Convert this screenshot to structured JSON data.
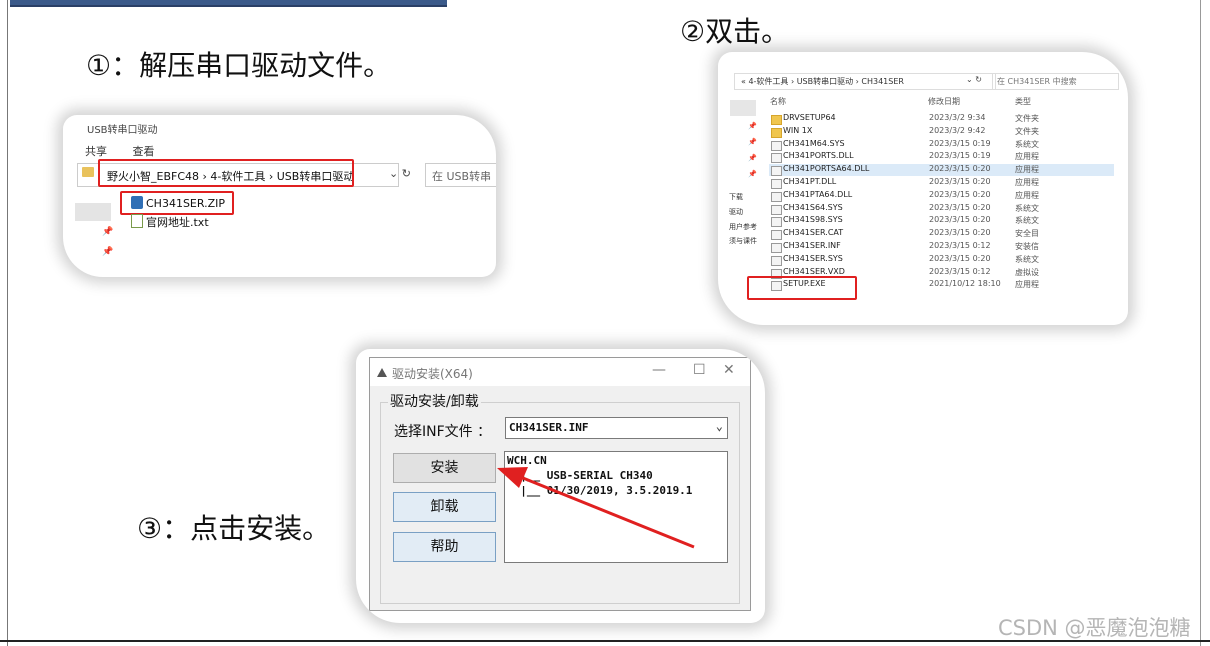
{
  "steps": {
    "step1": "①：解压串口驱动文件。",
    "step2": "②双击。",
    "step3": "③：点击安装。"
  },
  "panel1": {
    "window_title": "USB转串口驱动",
    "menu": [
      "共享",
      "查看"
    ],
    "address_path": "野火小智_EBFC48  ›  4-软件工具  ›  USB转串口驱动",
    "search_placeholder": "在 USB转串",
    "files": [
      {
        "name": "CH341SER.ZIP",
        "icon": "zip-icon"
      },
      {
        "name": "官网地址.txt",
        "icon": "txt-icon"
      }
    ]
  },
  "panel2": {
    "address_path": "«  4-软件工具  ›  USB转串口驱动  ›  CH341SER",
    "search_placeholder": "在 CH341SER 中搜索",
    "columns": [
      "名称",
      "修改日期",
      "类型"
    ],
    "sidebar": [
      "下载",
      "驱动",
      "用户参考",
      "须与课件"
    ],
    "files": [
      {
        "name": "DRVSETUP64",
        "date": "2023/3/2 9:34",
        "type": "文件夹",
        "folder": true
      },
      {
        "name": "WIN 1X",
        "date": "2023/3/2 9:42",
        "type": "文件夹",
        "folder": true
      },
      {
        "name": "CH341M64.SYS",
        "date": "2023/3/15 0:19",
        "type": "系统文",
        "folder": false
      },
      {
        "name": "CH341PORTS.DLL",
        "date": "2023/3/15 0:19",
        "type": "应用程",
        "folder": false
      },
      {
        "name": "CH341PORTSA64.DLL",
        "date": "2023/3/15 0:20",
        "type": "应用程",
        "folder": false
      },
      {
        "name": "CH341PT.DLL",
        "date": "2023/3/15 0:20",
        "type": "应用程",
        "folder": false
      },
      {
        "name": "CH341PTA64.DLL",
        "date": "2023/3/15 0:20",
        "type": "应用程",
        "folder": false
      },
      {
        "name": "CH341S64.SYS",
        "date": "2023/3/15 0:20",
        "type": "系统文",
        "folder": false
      },
      {
        "name": "CH341S98.SYS",
        "date": "2023/3/15 0:20",
        "type": "系统文",
        "folder": false
      },
      {
        "name": "CH341SER.CAT",
        "date": "2023/3/15 0:20",
        "type": "安全目",
        "folder": false
      },
      {
        "name": "CH341SER.INF",
        "date": "2023/3/15 0:12",
        "type": "安装信",
        "folder": false
      },
      {
        "name": "CH341SER.SYS",
        "date": "2023/3/15 0:20",
        "type": "系统文",
        "folder": false
      },
      {
        "name": "CH341SER.VXD",
        "date": "2023/3/15 0:12",
        "type": "虚拟设",
        "folder": false
      },
      {
        "name": "SETUP.EXE",
        "date": "2021/10/12 18:10",
        "type": "应用程",
        "folder": false
      }
    ]
  },
  "dialog": {
    "title": "驱动安装(X64)",
    "minimize": "—",
    "maximize": "☐",
    "close": "✕",
    "group_label": "驱动安装/卸载",
    "inf_label": "选择INF文件 ：",
    "inf_value": "CH341SER.INF",
    "buttons": {
      "install": "安装",
      "uninstall": "卸载",
      "help": "帮助"
    },
    "info_lines": [
      "WCH.CN",
      "  |__ USB-SERIAL CH340",
      "  |__ 01/30/2019, 3.5.2019.1"
    ]
  },
  "colors": {
    "highlight_red": "#e02020",
    "arrow_red": "#e02020"
  },
  "watermark": "CSDN @恶魔泡泡糖"
}
